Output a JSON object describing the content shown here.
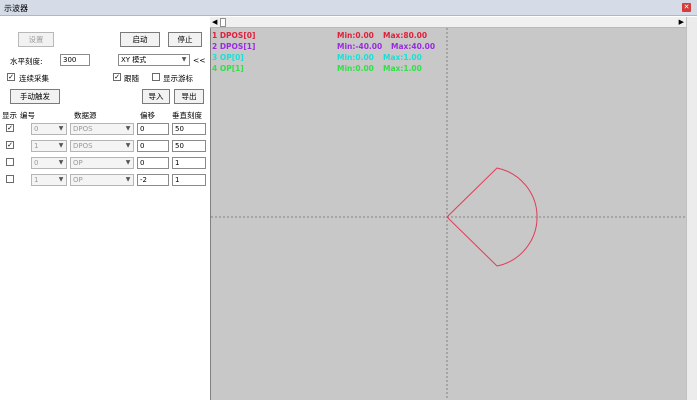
{
  "window": {
    "title": "示波器"
  },
  "toolbar": {
    "trigger_label": "设置",
    "start_label": "启动",
    "stop_label": "停止",
    "h_scale_label": "水平刻度:",
    "h_scale_value": "300",
    "mode_value": "XY 模式",
    "arrow_label": "<<",
    "continuous_label": "连续采集",
    "follow_label": "跟随",
    "show_cursor_label": "显示游标",
    "manual_trigger_label": "手动触发",
    "import_label": "导入",
    "export_label": "导出"
  },
  "table": {
    "headers": [
      "显示",
      "编号",
      "数据源",
      "偏移",
      "垂直刻度"
    ],
    "rows": [
      {
        "checked": true,
        "num": "0",
        "source": "DPOS",
        "offset": "0",
        "scale": "50"
      },
      {
        "checked": true,
        "num": "1",
        "source": "DPOS",
        "offset": "0",
        "scale": "50"
      },
      {
        "checked": false,
        "num": "0",
        "source": "OP",
        "offset": "0",
        "scale": "1"
      },
      {
        "checked": false,
        "num": "1",
        "source": "OP",
        "offset": "-2",
        "scale": "1"
      }
    ]
  },
  "legend": [
    {
      "name": "1 DPOS[0]",
      "min": "Min:0.00",
      "max": "Max:80.00",
      "color": "#e0203c"
    },
    {
      "name": "2 DPOS[1]",
      "min": "Min:-40.00",
      "max": "Max:40.00",
      "color": "#9a2be0"
    },
    {
      "name": "3 OP[0]",
      "min": "Min:0.00",
      "max": "Max:1.00",
      "color": "#18e0d8"
    },
    {
      "name": "4 OP[1]",
      "min": "Min:0.00",
      "max": "Max:1.00",
      "color": "#30e048"
    }
  ],
  "colors": {
    "trace": "#e03c5a",
    "scope_bg": "#c8c8c8",
    "grid": "#6e6e6e"
  },
  "icons": {
    "close": "close-icon",
    "scroll_left": "arrow-left-icon",
    "scroll_right": "arrow-right-icon",
    "dropdown": "chevron-down-icon",
    "check": "checkmark-icon"
  }
}
